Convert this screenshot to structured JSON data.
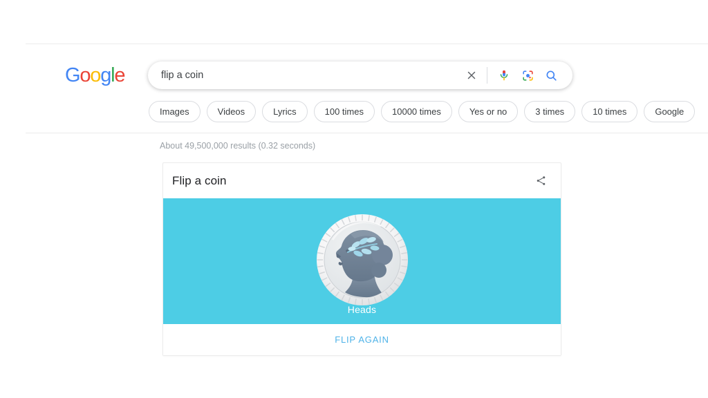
{
  "brand": {
    "name": "Google",
    "letters": [
      {
        "ch": "G",
        "color": "#4285F4"
      },
      {
        "ch": "o",
        "color": "#EA4335"
      },
      {
        "ch": "o",
        "color": "#FBBC05"
      },
      {
        "ch": "g",
        "color": "#4285F4"
      },
      {
        "ch": "l",
        "color": "#34A853"
      },
      {
        "ch": "e",
        "color": "#EA4335"
      }
    ]
  },
  "search": {
    "query": "flip a coin",
    "placeholder": "Search",
    "icons": [
      {
        "name": "clear-icon",
        "glyph": "close"
      },
      {
        "name": "microphone-icon",
        "glyph": "mic"
      },
      {
        "name": "google-lens-icon",
        "glyph": "lens"
      },
      {
        "name": "search-icon",
        "glyph": "magnifier"
      }
    ]
  },
  "filter_chips": [
    {
      "label": "Images"
    },
    {
      "label": "Videos"
    },
    {
      "label": "Lyrics"
    },
    {
      "label": "100 times"
    },
    {
      "label": "10000 times"
    },
    {
      "label": "Yes or no"
    },
    {
      "label": "3 times"
    },
    {
      "label": "10 times"
    },
    {
      "label": "Google"
    }
  ],
  "results": {
    "stats": "About 49,500,000 results (0.32 seconds)"
  },
  "coin_card": {
    "title": "Flip a coin",
    "share_icon": "share-icon",
    "result_label": "Heads",
    "flip_again_label": "FLIP AGAIN",
    "colors": {
      "stage_background": "#4dcde5",
      "coin_rim": "#f2f2f2",
      "coin_face": "#e8eaec",
      "portrait": "#76879a",
      "leaf": "#a9dced",
      "flip_again_text": "#4fb3e8",
      "result_text": "#ffffff"
    }
  }
}
